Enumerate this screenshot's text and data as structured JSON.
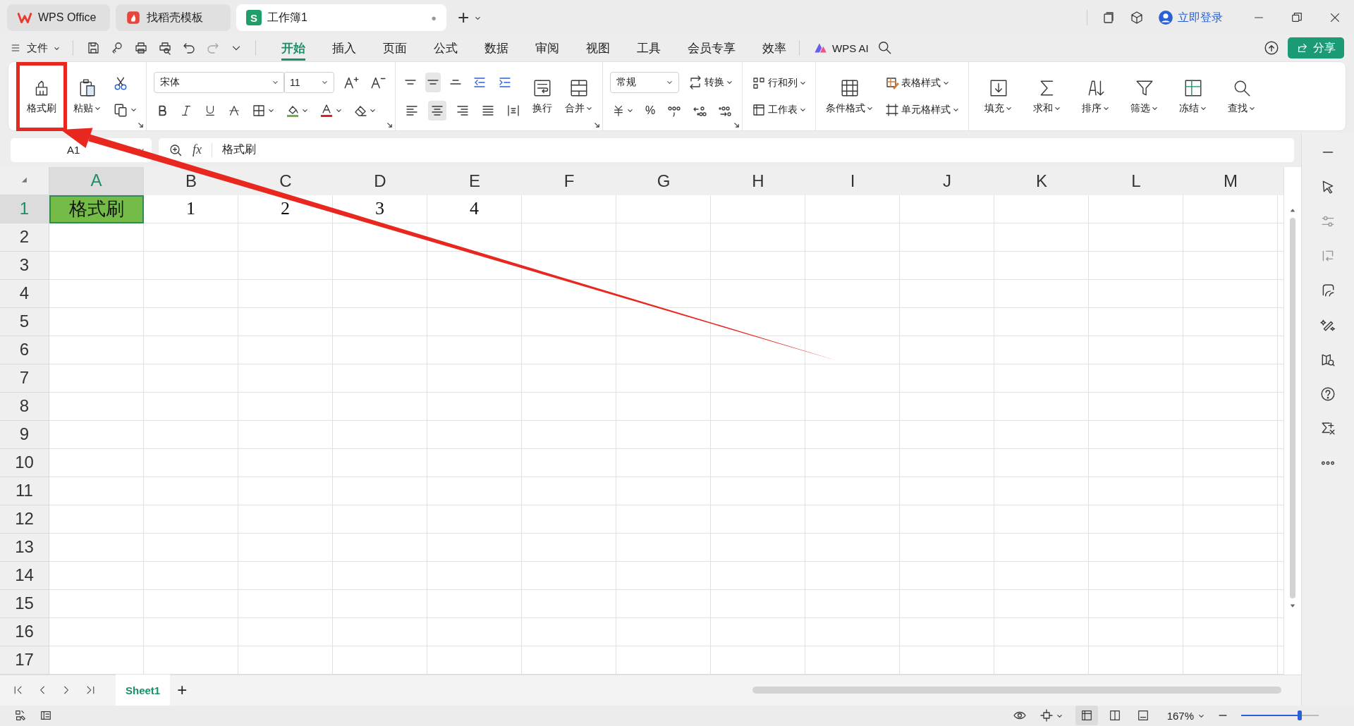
{
  "title_bar": {
    "tabs": [
      {
        "kind": "home",
        "label": "WPS Office",
        "selected": false
      },
      {
        "kind": "template",
        "label": "找稻壳模板",
        "selected": false
      },
      {
        "kind": "sheet",
        "label": "工作簿1",
        "logo_letter": "S",
        "unsaved_mark": "●",
        "selected": true
      }
    ],
    "new_tab": "+",
    "account": "立即登录"
  },
  "menu_bar": {
    "file": "文件",
    "tabs": [
      {
        "label": "开始",
        "selected": true
      },
      {
        "label": "插入",
        "selected": false
      },
      {
        "label": "页面",
        "selected": false
      },
      {
        "label": "公式",
        "selected": false
      },
      {
        "label": "数据",
        "selected": false
      },
      {
        "label": "审阅",
        "selected": false
      },
      {
        "label": "视图",
        "selected": false
      },
      {
        "label": "工具",
        "selected": false
      },
      {
        "label": "会员专享",
        "selected": false
      },
      {
        "label": "效率",
        "selected": false
      }
    ],
    "ai": "WPS AI",
    "share": "分享"
  },
  "ribbon": {
    "format_painter": {
      "label": "格式刷",
      "highlighted": true
    },
    "paste": "粘贴",
    "font_name": "宋体",
    "font_size": "11",
    "vertical_align": [
      {
        "selected": false
      },
      {
        "selected": true
      },
      {
        "selected": false
      }
    ],
    "horizontal_align": [
      {
        "selected": false
      },
      {
        "selected": true
      },
      {
        "selected": false
      },
      {
        "selected": false
      }
    ],
    "wrap": "换行",
    "merge": "合并",
    "number_format": "常规",
    "convert": "转换",
    "percent": "%",
    "rows_cols": "行和列",
    "worksheet": "工作表",
    "conditional_format": "条件格式",
    "table_style": "表格样式",
    "cell_style": "单元格样式",
    "tools": [
      "填充",
      "求和",
      "排序",
      "筛选",
      "冻结",
      "查找"
    ]
  },
  "formula_bar": {
    "name_box": "A1",
    "fx": "fx",
    "content": "格式刷"
  },
  "sheet": {
    "columns": [
      {
        "label": "A",
        "selected": true
      },
      {
        "label": "B",
        "selected": false
      },
      {
        "label": "C",
        "selected": false
      },
      {
        "label": "D",
        "selected": false
      },
      {
        "label": "E",
        "selected": false
      },
      {
        "label": "F",
        "selected": false
      },
      {
        "label": "G",
        "selected": false
      },
      {
        "label": "H",
        "selected": false
      },
      {
        "label": "I",
        "selected": false
      },
      {
        "label": "J",
        "selected": false
      },
      {
        "label": "K",
        "selected": false
      },
      {
        "label": "L",
        "selected": false
      },
      {
        "label": "M",
        "selected": false
      }
    ],
    "rows": [
      {
        "label": "1",
        "selected": true,
        "cells": [
          {
            "text": "格式刷",
            "selected": true,
            "color": "#74bb47"
          },
          {
            "text": "1",
            "selected": false
          },
          {
            "text": "2",
            "selected": false
          },
          {
            "text": "3",
            "selected": false
          },
          {
            "text": "4",
            "selected": false
          }
        ]
      },
      {
        "label": "2",
        "selected": false
      },
      {
        "label": "3",
        "selected": false
      },
      {
        "label": "4",
        "selected": false
      },
      {
        "label": "5",
        "selected": false
      },
      {
        "label": "6",
        "selected": false
      },
      {
        "label": "7",
        "selected": false
      },
      {
        "label": "8",
        "selected": false
      },
      {
        "label": "9",
        "selected": false
      },
      {
        "label": "10",
        "selected": false
      },
      {
        "label": "11",
        "selected": false
      },
      {
        "label": "12",
        "selected": false
      },
      {
        "label": "13",
        "selected": false
      },
      {
        "label": "14",
        "selected": false
      },
      {
        "label": "15",
        "selected": false
      },
      {
        "label": "16",
        "selected": false
      },
      {
        "label": "17",
        "selected": false
      }
    ]
  },
  "sheet_tabs": {
    "tabs": [
      {
        "label": "Sheet1",
        "selected": true
      }
    ],
    "add": "+"
  },
  "status_bar": {
    "views": [
      {
        "selected": true
      },
      {
        "selected": false
      },
      {
        "selected": false
      }
    ],
    "zoom": "167%",
    "zoom_slider": {
      "level": 0.75
    }
  },
  "annotation": {
    "arrow": true
  }
}
